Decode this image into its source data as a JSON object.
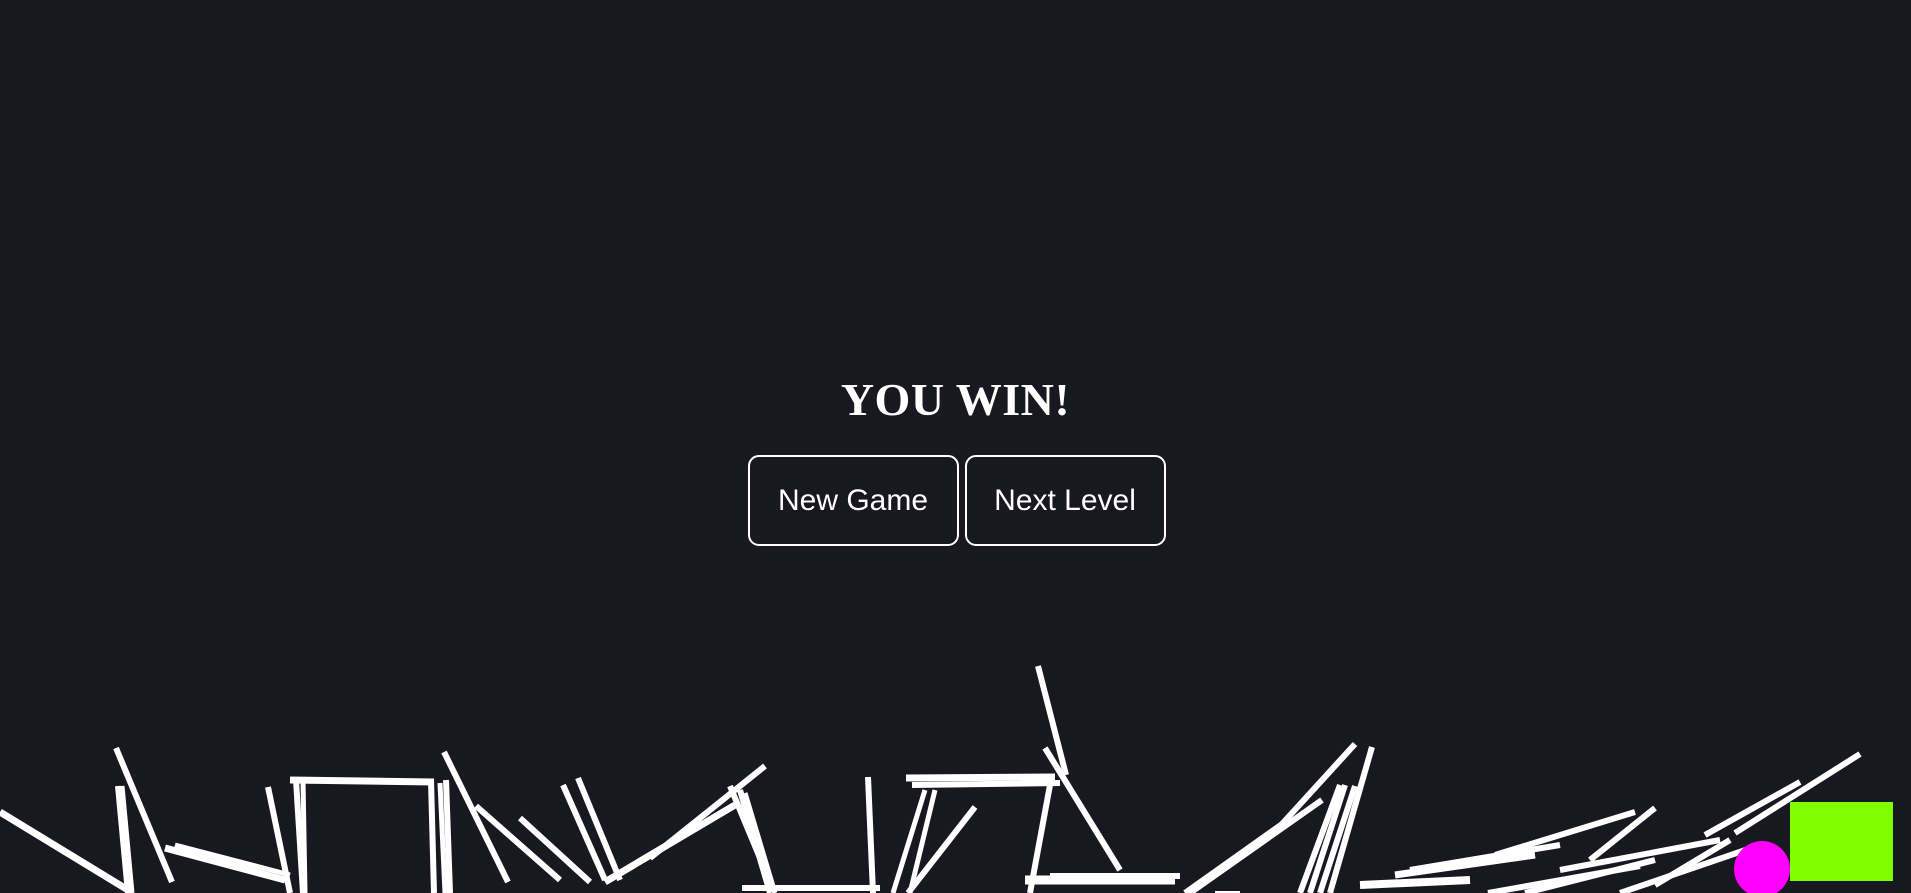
{
  "game": {
    "title": "YOU WIN!",
    "buttons": {
      "new_game": "New Game",
      "next_level": "Next Level"
    }
  },
  "colors": {
    "background": "#181820",
    "debris": "#ffffff",
    "ball": "#ff00ff",
    "goal": "#7fff00"
  },
  "objects": {
    "ball": "player-ball",
    "goal": "goal-square"
  }
}
